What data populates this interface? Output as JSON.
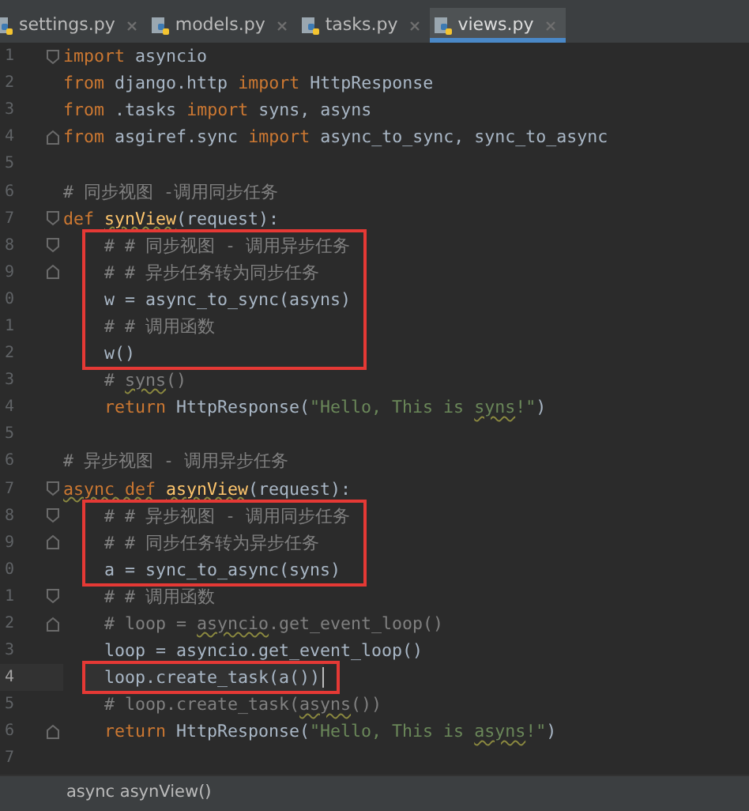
{
  "tabs": [
    {
      "label": "settings.py",
      "selected": false
    },
    {
      "label": "models.py",
      "selected": false
    },
    {
      "label": "tasks.py",
      "selected": false
    },
    {
      "label": "views.py",
      "selected": true
    }
  ],
  "sections": [
    {
      "boxed": false,
      "lines": [
        {
          "number": "1",
          "fold_start": true,
          "indented": false,
          "current": false,
          "tokens": [
            {
              "kind": "keyword",
              "text": "import"
            },
            {
              "kind": "name",
              "text": "asyncio"
            }
          ]
        },
        {
          "number": "2",
          "indented": false,
          "current": false,
          "tokens": [
            {
              "kind": "keyword",
              "text": "from"
            },
            {
              "kind": "name",
              "text": "django.http"
            },
            {
              "kind": "keyword",
              "text": "import"
            },
            {
              "kind": "name",
              "text": "HttpResponse"
            }
          ]
        },
        {
          "number": "3",
          "indented": false,
          "current": false,
          "tokens": [
            {
              "kind": "keyword",
              "text": "from"
            },
            {
              "kind": "name",
              "text": ".tasks"
            },
            {
              "kind": "keyword",
              "text": "import"
            },
            {
              "kind": "name",
              "text": "syns, asyns"
            }
          ]
        },
        {
          "number": "4",
          "fold_end": true,
          "indented": false,
          "current": false,
          "tokens": [
            {
              "kind": "keyword",
              "text": "from"
            },
            {
              "kind": "name",
              "text": "asgiref.sync"
            },
            {
              "kind": "keyword",
              "text": "import"
            },
            {
              "kind": "name",
              "text": "async_to_sync, sync_to_async"
            }
          ]
        },
        {
          "number": "5",
          "current": false
        },
        {
          "number": "6",
          "indented": false,
          "current": false,
          "tokens": [
            {
              "kind": "comment",
              "text": "# 同步视图 -调用同步任务"
            }
          ]
        },
        {
          "number": "7",
          "fold_start": true,
          "indented": false,
          "current": false,
          "tokens": [
            {
              "kind": "keyword",
              "text": "def"
            },
            {
              "kind": "funcdef",
              "text": "synView",
              "squiggle": true
            },
            {
              "kind": "name",
              "text": "(request):",
              "tight": true
            }
          ]
        }
      ]
    },
    {
      "boxed": true,
      "lines": [
        {
          "number": "8",
          "fold_start": true,
          "indented": true,
          "current": false,
          "tokens": [
            {
              "kind": "comment",
              "text": "# # 同步视图 - 调用异步任务"
            }
          ]
        },
        {
          "number": "9",
          "fold_end": true,
          "indented": true,
          "current": false,
          "tokens": [
            {
              "kind": "comment",
              "text": "# # 异步任务转为同步任务"
            }
          ]
        },
        {
          "number": "0",
          "indented": true,
          "current": false,
          "tokens": [
            {
              "kind": "name",
              "text": "w = async_to_sync(asyns)"
            }
          ]
        },
        {
          "number": "1",
          "indented": true,
          "current": false,
          "tokens": [
            {
              "kind": "comment",
              "text": "# # 调用函数"
            }
          ]
        },
        {
          "number": "2",
          "indented": true,
          "current": false,
          "tokens": [
            {
              "kind": "name",
              "text": "w()"
            }
          ]
        }
      ]
    },
    {
      "boxed": false,
      "lines": [
        {
          "number": "3",
          "indented": true,
          "current": false,
          "tokens": [
            {
              "kind": "comment",
              "text": "#"
            },
            {
              "kind": "comment",
              "text": "syns",
              "squiggle": true
            },
            {
              "kind": "comment",
              "text": "()",
              "tight": true
            }
          ]
        },
        {
          "number": "4",
          "indented": true,
          "current": false,
          "tokens": [
            {
              "kind": "keyword",
              "text": "return"
            },
            {
              "kind": "name",
              "text": "HttpResponse("
            },
            {
              "kind": "string",
              "text": "\"Hello, This is",
              "tight": true
            },
            {
              "kind": "string",
              "text": "syns",
              "squiggle": true
            },
            {
              "kind": "string",
              "text": "!\"",
              "tight": true
            },
            {
              "kind": "name",
              "text": ")",
              "tight": true
            }
          ]
        },
        {
          "number": "5",
          "current": false
        },
        {
          "number": "6",
          "indented": false,
          "current": false,
          "tokens": [
            {
              "kind": "comment",
              "text": "# 异步视图 - 调用异步任务"
            }
          ]
        },
        {
          "number": "7",
          "fold_start": true,
          "indented": false,
          "current": false,
          "tokens": [
            {
              "kind": "keyword",
              "text": "async def",
              "squiggle": true
            },
            {
              "kind": "funcdef",
              "text": "asynView",
              "squiggle": true
            },
            {
              "kind": "name",
              "text": "(request):",
              "tight": true
            }
          ]
        }
      ]
    },
    {
      "boxed": true,
      "lines": [
        {
          "number": "8",
          "fold_start": true,
          "indented": true,
          "current": false,
          "tokens": [
            {
              "kind": "comment",
              "text": "# # 异步视图 - 调用同步任务"
            }
          ]
        },
        {
          "number": "9",
          "fold_end": true,
          "indented": true,
          "current": false,
          "tokens": [
            {
              "kind": "comment",
              "text": "# # 同步任务转为异步任务"
            }
          ]
        },
        {
          "number": "0",
          "indented": true,
          "current": false,
          "tokens": [
            {
              "kind": "name",
              "text": "a = sync_to_async(syns)"
            }
          ]
        }
      ]
    },
    {
      "boxed": false,
      "lines": [
        {
          "number": "1",
          "fold_start": true,
          "indented": true,
          "current": false,
          "tokens": [
            {
              "kind": "comment",
              "text": "# # 调用函数"
            }
          ]
        },
        {
          "number": "2",
          "fold_end": true,
          "indented": true,
          "current": false,
          "tokens": [
            {
              "kind": "comment",
              "text": "# loop ="
            },
            {
              "kind": "comment",
              "text": "asyncio",
              "squiggle": true
            },
            {
              "kind": "comment",
              "text": ".get_event_loop()",
              "tight": true
            }
          ]
        },
        {
          "number": "3",
          "indented": true,
          "current": false,
          "tokens": [
            {
              "kind": "name",
              "text": "loop = asyncio.get_event_loop()"
            }
          ]
        }
      ]
    },
    {
      "boxed": true,
      "lines": [
        {
          "number": "4",
          "indented": true,
          "current": true,
          "tokens": [
            {
              "kind": "name",
              "text": "loop.create_task(a())"
            }
          ]
        }
      ]
    },
    {
      "boxed": false,
      "lines": [
        {
          "number": "5",
          "indented": true,
          "current": false,
          "tokens": [
            {
              "kind": "comment",
              "text": "# loop.create_task("
            },
            {
              "kind": "comment",
              "text": "asyns",
              "squiggle": true,
              "tight": true
            },
            {
              "kind": "comment",
              "text": "())",
              "tight": true
            }
          ]
        },
        {
          "number": "6",
          "fold_end": true,
          "indented": true,
          "current": false,
          "tokens": [
            {
              "kind": "keyword",
              "text": "return"
            },
            {
              "kind": "name",
              "text": "HttpResponse("
            },
            {
              "kind": "string",
              "text": "\"Hello, This is",
              "tight": true
            },
            {
              "kind": "string",
              "text": "asyns",
              "squiggle": true
            },
            {
              "kind": "string",
              "text": "!\"",
              "tight": true
            },
            {
              "kind": "name",
              "text": ")",
              "tight": true
            }
          ]
        },
        {
          "number": "7",
          "current": false
        }
      ]
    }
  ],
  "breadcrumb": "async asynView()"
}
